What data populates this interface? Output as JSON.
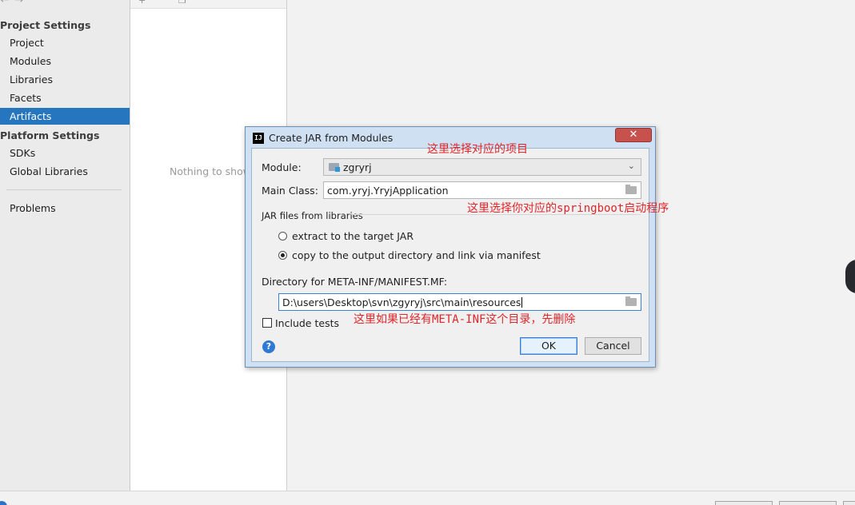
{
  "sidebar": {
    "project_settings_header": "Project Settings",
    "project_items": [
      {
        "label": "Project"
      },
      {
        "label": "Modules"
      },
      {
        "label": "Libraries"
      },
      {
        "label": "Facets"
      },
      {
        "label": "Artifacts",
        "selected": true
      }
    ],
    "platform_settings_header": "Platform Settings",
    "platform_items": [
      {
        "label": "SDKs"
      },
      {
        "label": "Global Libraries"
      }
    ],
    "problems_label": "Problems"
  },
  "artifacts_panel": {
    "empty_text": "Nothing to show"
  },
  "dialog": {
    "title": "Create JAR from Modules",
    "close_symbol": "✕",
    "module_label": "Module:",
    "module_value": "zgryrj",
    "main_class_label": "Main Class:",
    "main_class_value": "com.yryj.YryjApplication",
    "jar_files_label": "JAR files from libraries",
    "option_extract": "extract to the target JAR",
    "option_copy": "copy to the output directory and link via manifest",
    "selected_option": "copy",
    "manifest_dir_label": "Directory for META-INF/MANIFEST.MF:",
    "manifest_dir_value": "D:\\users\\Desktop\\svn\\zgyryj\\src\\main\\resources",
    "include_tests_label": "Include tests",
    "include_tests_checked": false,
    "ok_label": "OK",
    "cancel_label": "Cancel",
    "help_symbol": "?"
  },
  "annotations": {
    "module_note": "这里选择对应的项目",
    "main_class_note": "这里选择你对应的springboot启动程序",
    "manifest_note": "这里如果已经有META-INF这个目录，先删除"
  },
  "colors": {
    "selection": "#2675bf",
    "annotation": "#e0262a",
    "dialog_frame": "#cfe0f2",
    "close_button": "#c7514d"
  }
}
